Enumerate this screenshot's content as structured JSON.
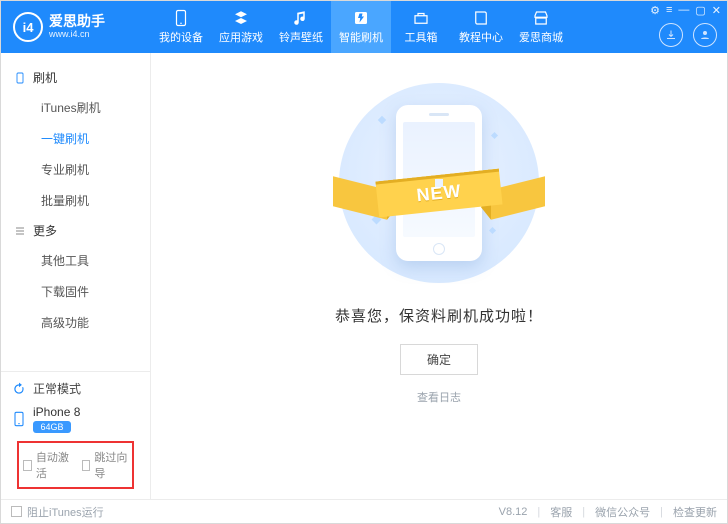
{
  "header": {
    "logo": {
      "badge": "i4",
      "title": "爱思助手",
      "url": "www.i4.cn"
    },
    "nav": [
      {
        "label": "我的设备",
        "icon": "device"
      },
      {
        "label": "应用游戏",
        "icon": "apps"
      },
      {
        "label": "铃声壁纸",
        "icon": "music"
      },
      {
        "label": "智能刷机",
        "icon": "flash",
        "active": true
      },
      {
        "label": "工具箱",
        "icon": "toolbox"
      },
      {
        "label": "教程中心",
        "icon": "book"
      },
      {
        "label": "爱思商城",
        "icon": "store"
      }
    ],
    "window_controls": {
      "settings": "⚙",
      "menu": "≡",
      "minimize": "—",
      "maximize": "▢",
      "close": "✕"
    }
  },
  "sidebar": {
    "groups": [
      {
        "title": "刷机",
        "icon": "phone-outline",
        "items": [
          {
            "label": "iTunes刷机"
          },
          {
            "label": "一键刷机",
            "active": true
          },
          {
            "label": "专业刷机"
          },
          {
            "label": "批量刷机"
          }
        ]
      },
      {
        "title": "更多",
        "icon": "menu-lines",
        "items": [
          {
            "label": "其他工具"
          },
          {
            "label": "下载固件"
          },
          {
            "label": "高级功能"
          }
        ]
      }
    ],
    "mode_label": "正常模式",
    "device": {
      "name": "iPhone 8",
      "capacity": "64GB"
    },
    "options": {
      "auto_activate": "自动激活",
      "skip_wizard": "跳过向导"
    }
  },
  "main": {
    "ribbon_text": "NEW",
    "success_text": "恭喜您，保资料刷机成功啦！",
    "confirm_label": "确定",
    "view_log_label": "查看日志"
  },
  "footer": {
    "block_itunes": "阻止iTunes运行",
    "version": "V8.12",
    "support": "客服",
    "wechat": "微信公众号",
    "check_update": "检查更新"
  }
}
